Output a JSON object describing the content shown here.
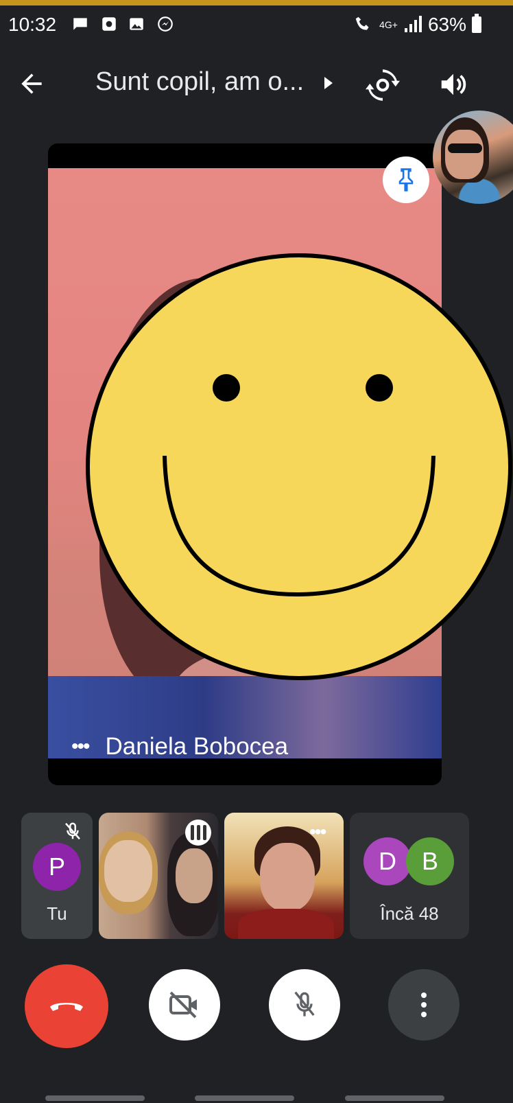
{
  "status_bar": {
    "time": "10:32",
    "network": "4G+",
    "battery": "63%"
  },
  "meeting": {
    "title": "Sunt copil, am o...",
    "main_speaker_name": "Daniela Bobocea"
  },
  "participants": [
    {
      "initial": "P",
      "label": "Tu",
      "color": "#8e24aa"
    },
    {
      "initial": "D",
      "color": "#ab47bc"
    },
    {
      "initial": "B",
      "color": "#5a9e3a"
    }
  ],
  "more_participants_label": "Încă 48",
  "controls": {
    "end_call_color": "#ea4335"
  },
  "colors": {
    "background": "#202124",
    "smiley": "#f6d75a"
  }
}
